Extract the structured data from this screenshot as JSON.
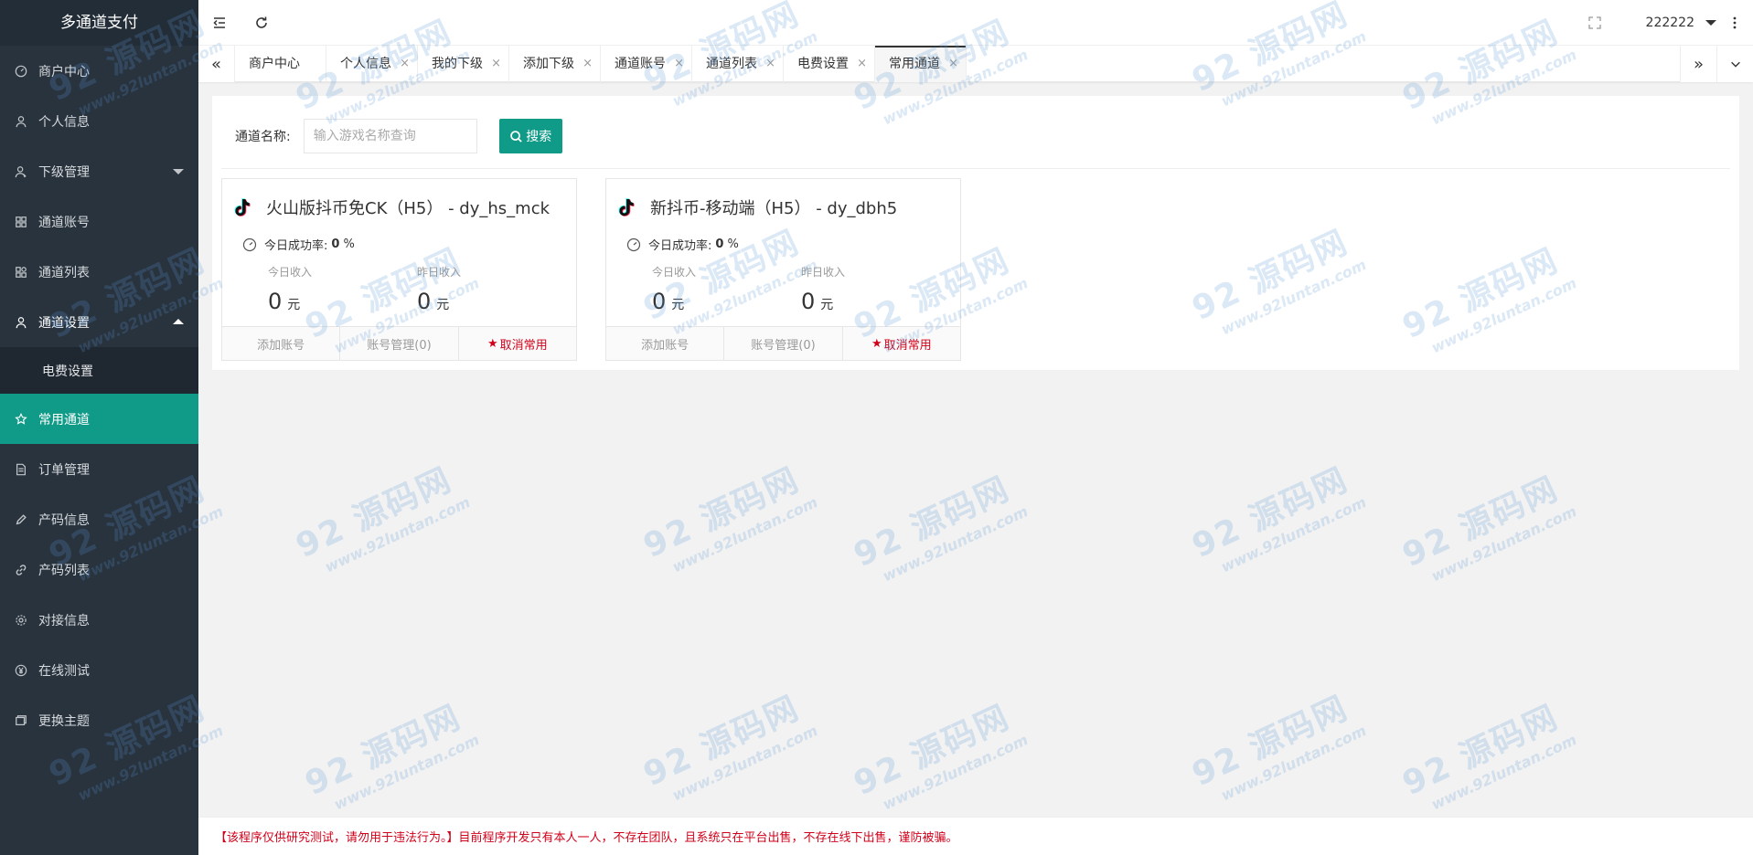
{
  "app": {
    "title": "多通道支付"
  },
  "sidebar": {
    "items": [
      {
        "label": "商户中心",
        "icon": "dashboard-icon"
      },
      {
        "label": "个人信息",
        "icon": "user-icon"
      },
      {
        "label": "下级管理",
        "icon": "users-icon"
      },
      {
        "label": "通道账号",
        "icon": "grid-icon"
      },
      {
        "label": "通道列表",
        "icon": "apps-icon"
      },
      {
        "label": "通道设置",
        "icon": "user-settings-icon"
      },
      {
        "label": "常用通道",
        "icon": "star-icon"
      },
      {
        "label": "订单管理",
        "icon": "document-icon"
      },
      {
        "label": "产码信息",
        "icon": "pencil-icon"
      },
      {
        "label": "产码列表",
        "icon": "link-icon"
      },
      {
        "label": "对接信息",
        "icon": "gear-icon"
      },
      {
        "label": "在线测试",
        "icon": "yen-icon"
      },
      {
        "label": "更换主题",
        "icon": "theme-icon"
      }
    ],
    "sub_items": [
      {
        "label": "电费设置"
      }
    ],
    "active": "常用通道"
  },
  "header": {
    "username": "222222"
  },
  "tabs": [
    {
      "label": "商户中心"
    },
    {
      "label": "个人信息"
    },
    {
      "label": "我的下级"
    },
    {
      "label": "添加下级"
    },
    {
      "label": "通道账号"
    },
    {
      "label": "通道列表"
    },
    {
      "label": "电费设置"
    },
    {
      "label": "常用通道",
      "active": true
    }
  ],
  "tab_close_glyph": "×",
  "search": {
    "label": "通道名称:",
    "placeholder": "输入游戏名称查询",
    "button": "搜索"
  },
  "cards": [
    {
      "title": "火山版抖币免CK（H5） - dy_hs_mck",
      "rate_label": "今日成功率:",
      "rate_value": "0",
      "rate_unit": "%",
      "today_label": "今日收入",
      "today_value": "0",
      "yesterday_label": "昨日收入",
      "yesterday_value": "0",
      "unit": "元",
      "actions": {
        "add": "添加账号",
        "manage": "账号管理(0)",
        "remove": "取消常用"
      }
    },
    {
      "title": "新抖币-移动端（H5） - dy_dbh5",
      "rate_label": "今日成功率:",
      "rate_value": "0",
      "rate_unit": "%",
      "today_label": "今日收入",
      "today_value": "0",
      "yesterday_label": "昨日收入",
      "yesterday_value": "0",
      "unit": "元",
      "actions": {
        "add": "添加账号",
        "manage": "账号管理(0)",
        "remove": "取消常用"
      }
    }
  ],
  "notice": "【该程序仅供研究测试，请勿用于违法行为。】目前程序开发只有本人一人，不存在团队，且系统只在平台出售，不存在线下出售，谨防被骗。",
  "watermark": {
    "big": "92 源码网",
    "small": "www.92luntan.com"
  },
  "colors": {
    "accent": "#109a88",
    "sidebar": "#28333e",
    "danger": "#d0021b"
  }
}
